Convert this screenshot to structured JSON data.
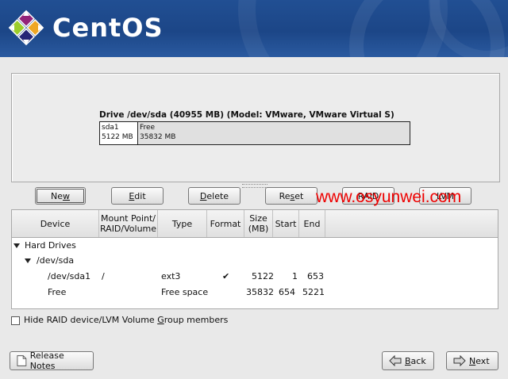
{
  "banner": {
    "brand": "CentOS"
  },
  "drive": {
    "title": "Drive /dev/sda (40955 MB) (Model: VMware, VMware Virtual S)",
    "segments": [
      {
        "name": "sda1",
        "size": "5122 MB"
      },
      {
        "name": "Free",
        "size": "35832 MB"
      }
    ]
  },
  "buttons": {
    "new": {
      "pre": "Ne",
      "key": "w",
      "post": ""
    },
    "edit": {
      "pre": "",
      "key": "E",
      "post": "dit"
    },
    "delete": {
      "pre": "",
      "key": "D",
      "post": "elete"
    },
    "reset": {
      "pre": "Re",
      "key": "s",
      "post": "et"
    },
    "raid": "RAID",
    "lvm": "LVM"
  },
  "watermark": "www.osyunwei.com",
  "table": {
    "headers": {
      "device": "Device",
      "mount": "Mount Point/ RAID/Volume",
      "type": "Type",
      "format": "Format",
      "size": "Size (MB)",
      "start": "Start",
      "end": "End"
    },
    "hard_drives": "Hard Drives",
    "dev_sda": "/dev/sda",
    "rows": [
      {
        "device": "/dev/sda1",
        "mount": "/",
        "type": "ext3",
        "format": "✔",
        "size": "5122",
        "start": "1",
        "end": "653"
      },
      {
        "device": "Free",
        "mount": "",
        "type": "Free space",
        "format": "",
        "size": "35832",
        "start": "654",
        "end": "5221"
      }
    ]
  },
  "hide_option": {
    "pre": "Hide RAID device/LVM Volume ",
    "key": "G",
    "post": "roup members"
  },
  "footer": {
    "release_notes": "Release Notes",
    "back": {
      "pre": "",
      "key": "B",
      "post": "ack"
    },
    "next": {
      "pre": "",
      "key": "N",
      "post": "ext"
    }
  }
}
